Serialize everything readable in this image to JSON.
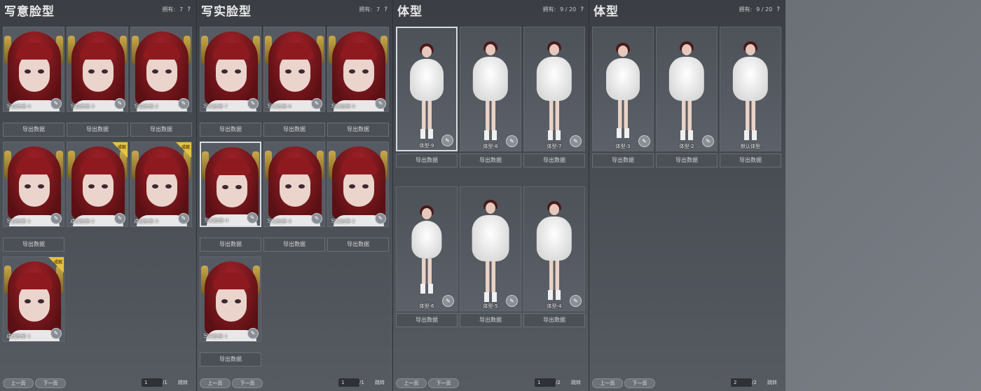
{
  "panels": [
    {
      "title": "写意脸型",
      "owned_label": "拥有:",
      "owned_value": "7",
      "kind": "face",
      "items": [
        {
          "label": "写意脸型-4",
          "button": "导出数据",
          "edit": true,
          "badge": ""
        },
        {
          "label": "写意脸型-3",
          "button": "导出数据",
          "edit": true,
          "badge": ""
        },
        {
          "label": "写意脸型-2",
          "button": "导出数据",
          "edit": true,
          "badge": ""
        },
        {
          "label": "写意脸型-1",
          "button": "导出数据",
          "edit": true,
          "badge": ""
        },
        {
          "label": "成就脸型-2",
          "button": "",
          "edit": true,
          "badge": "成就"
        },
        {
          "label": "成就脸型-3",
          "button": "",
          "edit": true,
          "badge": "成就"
        },
        {
          "label": "成就脸型-1",
          "button": "",
          "edit": true,
          "badge": "成就"
        }
      ],
      "pager": {
        "prev": "上一页",
        "next": "下一页",
        "current": "1",
        "total": "/1",
        "jump": "跳转"
      }
    },
    {
      "title": "写实脸型",
      "owned_label": "拥有:",
      "owned_value": "7",
      "kind": "face",
      "items": [
        {
          "label": "写实脸型-7",
          "button": "导出数据",
          "edit": true,
          "badge": ""
        },
        {
          "label": "写实脸型-6",
          "button": "导出数据",
          "edit": true,
          "badge": ""
        },
        {
          "label": "写实脸型-5",
          "button": "导出数据",
          "edit": true,
          "badge": ""
        },
        {
          "label": "写实脸型-4",
          "button": "导出数据",
          "edit": true,
          "badge": "",
          "selected": true
        },
        {
          "label": "写实脸型-3",
          "button": "导出数据",
          "edit": true,
          "badge": ""
        },
        {
          "label": "写实脸型-2",
          "button": "导出数据",
          "edit": true,
          "badge": ""
        },
        {
          "label": "写实脸型-1",
          "button": "导出数据",
          "edit": true,
          "badge": ""
        }
      ],
      "pager": {
        "prev": "上一页",
        "next": "下一页",
        "current": "1",
        "total": "/1",
        "jump": "跳转"
      }
    },
    {
      "title": "体型",
      "owned_label": "拥有:",
      "owned_value": "9 / 20",
      "kind": "body",
      "items": [
        {
          "label": "体型-9",
          "button": "导出数据",
          "edit": true,
          "badge": "",
          "selected": true
        },
        {
          "label": "体型-8",
          "button": "导出数据",
          "edit": true,
          "badge": ""
        },
        {
          "label": "体型-7",
          "button": "导出数据",
          "edit": true,
          "badge": ""
        },
        {
          "label": "体型-6",
          "button": "导出数据",
          "edit": true,
          "badge": ""
        },
        {
          "label": "体型-5",
          "button": "导出数据",
          "edit": true,
          "badge": ""
        },
        {
          "label": "体型-4",
          "button": "导出数据",
          "edit": true,
          "badge": ""
        }
      ],
      "pager": {
        "prev": "上一页",
        "next": "下一页",
        "current": "1",
        "total": "/2",
        "jump": "跳转"
      }
    },
    {
      "title": "体型",
      "owned_label": "拥有:",
      "owned_value": "9 / 20",
      "kind": "body",
      "items": [
        {
          "label": "体型-3",
          "button": "导出数据",
          "edit": true,
          "badge": ""
        },
        {
          "label": "体型-2",
          "button": "导出数据",
          "edit": true,
          "badge": ""
        },
        {
          "label": "默认体型",
          "button": "导出数据",
          "edit": false,
          "badge": ""
        }
      ],
      "pager": {
        "prev": "上一页",
        "next": "下一页",
        "current": "2",
        "total": "/2",
        "jump": "跳转"
      }
    }
  ],
  "icons": {
    "help": "?",
    "edit": "✎"
  }
}
